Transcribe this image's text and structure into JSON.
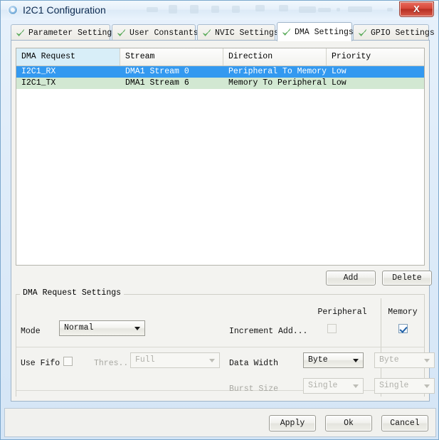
{
  "window": {
    "title": "I2C1 Configuration",
    "close_label": "X"
  },
  "tabs": [
    {
      "label": "Parameter Settings",
      "icon": "check-icon",
      "selected": false
    },
    {
      "label": "User Constants",
      "icon": "check-icon",
      "selected": false
    },
    {
      "label": "NVIC Settings",
      "icon": "check-icon",
      "selected": false
    },
    {
      "label": "DMA Settings",
      "icon": "check-icon",
      "selected": true
    },
    {
      "label": "GPIO Settings",
      "icon": "check-icon",
      "selected": false
    }
  ],
  "table": {
    "columns": [
      "DMA Request",
      "Stream",
      "Direction",
      "Priority"
    ],
    "rows": [
      {
        "dma_request": "I2C1_RX",
        "stream": "DMA1 Stream 0",
        "direction": "Peripheral To Memory",
        "priority": "Low",
        "selected": true
      },
      {
        "dma_request": "I2C1_TX",
        "stream": "DMA1 Stream 6",
        "direction": "Memory To Peripheral",
        "priority": "Low",
        "selected": false
      }
    ]
  },
  "table_buttons": {
    "add": "Add",
    "delete": "Delete"
  },
  "settings": {
    "group_title": "DMA Request Settings",
    "col_peripheral": "Peripheral",
    "col_memory": "Memory",
    "mode_label": "Mode",
    "mode_value": "Normal",
    "increment_label": "Increment Add...",
    "increment_peripheral_checked": false,
    "increment_memory_checked": true,
    "use_fifo_label": "Use Fifo",
    "use_fifo_checked": false,
    "threshold_label": "Thres...",
    "threshold_value": "Full",
    "data_width_label": "Data Width",
    "data_width_peripheral": "Byte",
    "data_width_memory": "Byte",
    "burst_size_label": "Burst Size",
    "burst_size_peripheral": "Single",
    "burst_size_memory": "Single"
  },
  "footer": {
    "apply": "Apply",
    "ok": "Ok",
    "cancel": "Cancel"
  },
  "colors": {
    "selected_row": "#3399f0",
    "alt_row": "#d2e8d2",
    "key_column_header": "#d8eef8",
    "close_button": "#c7392a",
    "check_icon": "#6ec46e"
  }
}
